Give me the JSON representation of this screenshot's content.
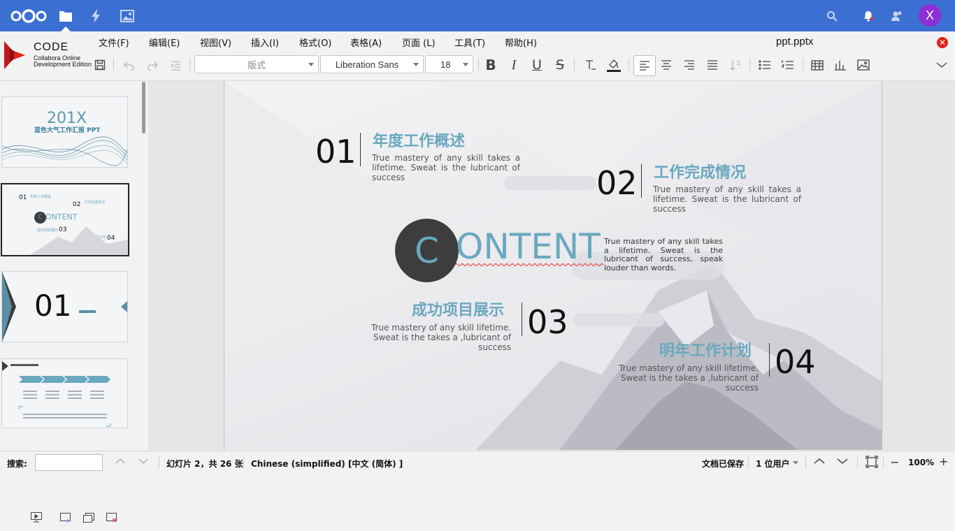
{
  "colors": {
    "nav": "#3b6fd1",
    "accent_heading": "#6aa8bf",
    "close": "#e2231a",
    "avatar": "#8e2ed6"
  },
  "topbar": {
    "icons": [
      "nextcloud-logo-icon",
      "files-icon",
      "activity-icon",
      "gallery-icon",
      "search-icon",
      "notifications-icon",
      "contacts-icon"
    ],
    "avatar_letter": "X"
  },
  "branding": {
    "name": "CODE",
    "line1": "Collabora Online",
    "line2": "Development Edition"
  },
  "menu": [
    "文件(F)",
    "编辑(E)",
    "视图(V)",
    "插入(I)",
    "格式(O)",
    "表格(A)",
    "页面 (L)",
    "工具(T)",
    "帮助(H)"
  ],
  "document": {
    "title": "ppt.pptx"
  },
  "toolbar": {
    "style_value": "版式",
    "font_value": "Liberation Sans",
    "size_value": "18"
  },
  "slide": {
    "center_letter": "C",
    "center_word": "ONTENT",
    "center_text": "True mastery of any skill takes a lifetime. Sweat is the lubricant of success, speak louder than words.",
    "items": [
      {
        "number": "01",
        "title": "年度工作概述",
        "text": "True mastery of any skill takes a lifetime. Sweat is the lubricant of success"
      },
      {
        "number": "02",
        "title": "工作完成情况",
        "text": "True mastery of any skill takes a lifetime. Sweat is the lubricant of success"
      },
      {
        "number": "03",
        "title": "成功项目展示",
        "text": "True mastery of any skill lifetime. Sweat is the takes a ,lubricant of success"
      },
      {
        "number": "04",
        "title": "明年工作计划",
        "text": "True mastery of any skill lifetime. Sweat is the takes a ,lubricant of success"
      }
    ]
  },
  "thumbnails": {
    "t1_year": "201X",
    "t1_title": "蓝色大气工作汇报 PPT",
    "t3_number": "01"
  },
  "statusbar": {
    "search_label": "搜索:",
    "search_value": "",
    "slide_info": "幻灯片 2，共 26 张",
    "language": "Chinese (simplified) [中文 (简体) ]",
    "saved": "文档已保存",
    "users": "1 位用户",
    "zoom": "100%"
  }
}
